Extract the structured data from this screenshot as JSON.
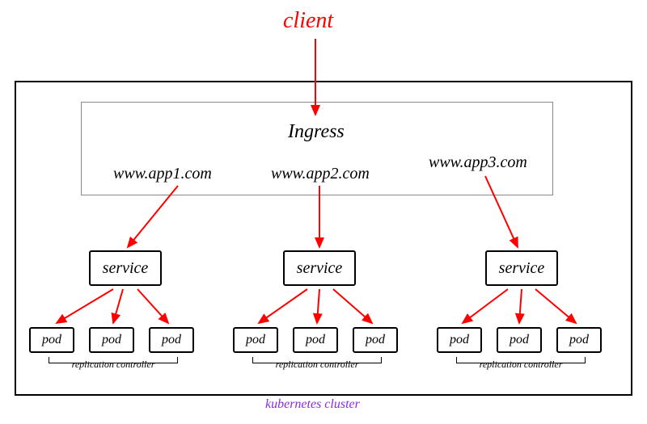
{
  "client_label": "client",
  "ingress_label": "Ingress",
  "cluster_label": "kubernetes cluster",
  "routes": {
    "app1": {
      "host": "www.app1.com",
      "service_label": "service",
      "replication_label": "replication controller",
      "pods": [
        "pod",
        "pod",
        "pod"
      ]
    },
    "app2": {
      "host": "www.app2.com",
      "service_label": "service",
      "replication_label": "replication controller",
      "pods": [
        "pod",
        "pod",
        "pod"
      ]
    },
    "app3": {
      "host": "www.app3.com",
      "service_label": "service",
      "replication_label": "replication controller",
      "pods": [
        "pod",
        "pod",
        "pod"
      ]
    }
  },
  "colors": {
    "arrow": "#ff0000",
    "cluster_label": "#8a2be2"
  }
}
